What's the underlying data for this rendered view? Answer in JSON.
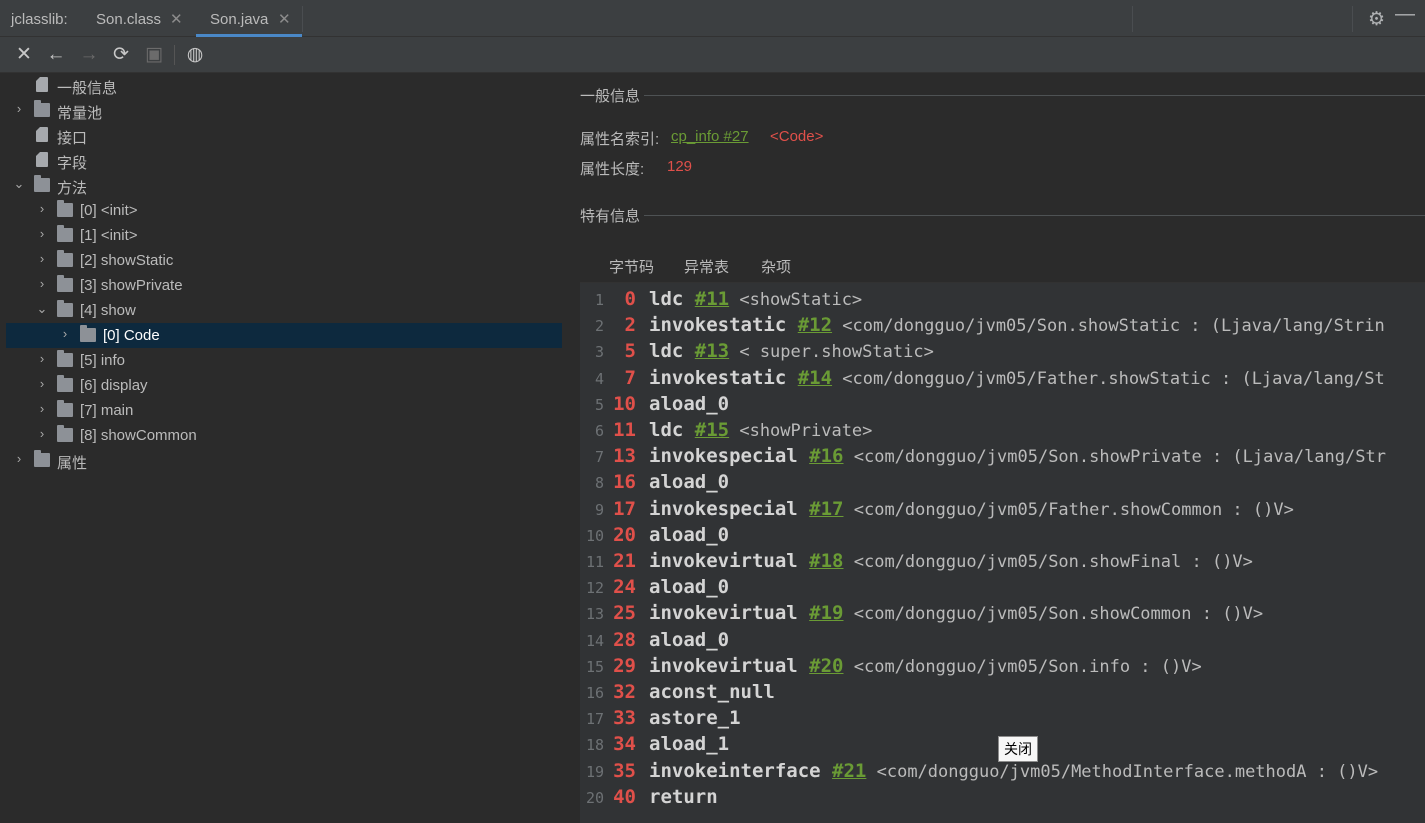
{
  "tabbar": {
    "app_label": "jclasslib:",
    "tabs": [
      {
        "label": "Son.class",
        "active": false
      },
      {
        "label": "Son.java",
        "active": true
      }
    ],
    "close_glyph": "✕",
    "settings_icon": "gear-icon",
    "minimize_glyph": "—"
  },
  "toolbar": {
    "buttons": [
      {
        "name": "close-icon",
        "glyph": "✕"
      },
      {
        "name": "back-arrow-icon",
        "glyph": "←"
      },
      {
        "name": "forward-arrow-icon",
        "glyph": "→",
        "disabled": true
      },
      {
        "name": "refresh-icon",
        "glyph": "⟳"
      },
      {
        "name": "save-icon",
        "glyph": "▣",
        "disabled": true
      },
      {
        "name": "web-browser-icon",
        "glyph": "◍"
      }
    ]
  },
  "tree": {
    "items": [
      {
        "label": "一般信息",
        "type": "file",
        "depth": 0,
        "expander": ""
      },
      {
        "label": "常量池",
        "type": "folder",
        "depth": 0,
        "expander": "›"
      },
      {
        "label": "接口",
        "type": "file",
        "depth": 0,
        "expander": ""
      },
      {
        "label": "字段",
        "type": "file",
        "depth": 0,
        "expander": ""
      },
      {
        "label": "方法",
        "type": "folder",
        "depth": 0,
        "expander": "⌄"
      },
      {
        "label": "[0] <init>",
        "type": "folder",
        "depth": 1,
        "expander": "›"
      },
      {
        "label": "[1] <init>",
        "type": "folder",
        "depth": 1,
        "expander": "›"
      },
      {
        "label": "[2] showStatic",
        "type": "folder",
        "depth": 1,
        "expander": "›"
      },
      {
        "label": "[3] showPrivate",
        "type": "folder",
        "depth": 1,
        "expander": "›"
      },
      {
        "label": "[4] show",
        "type": "folder",
        "depth": 1,
        "expander": "⌄"
      },
      {
        "label": "[0] Code",
        "type": "folder",
        "depth": 2,
        "expander": "›",
        "selected": true
      },
      {
        "label": "[5] info",
        "type": "folder",
        "depth": 1,
        "expander": "›"
      },
      {
        "label": "[6] display",
        "type": "folder",
        "depth": 1,
        "expander": "›"
      },
      {
        "label": "[7] main",
        "type": "folder",
        "depth": 1,
        "expander": "›"
      },
      {
        "label": "[8] showCommon",
        "type": "folder",
        "depth": 1,
        "expander": "›"
      },
      {
        "label": "属性",
        "type": "folder",
        "depth": 0,
        "expander": "›"
      }
    ]
  },
  "general": {
    "section_title": "一般信息",
    "name_index_label": "属性名索引:",
    "name_index_link": "cp_info #27",
    "name_index_value": "<Code>",
    "length_label": "属性长度:",
    "length_value": "129"
  },
  "specific": {
    "section_title": "特有信息",
    "tabs": [
      "字节码",
      "异常表",
      "杂项"
    ],
    "active_tab": "字节码"
  },
  "bytecode": [
    {
      "ln": "1",
      "off": "0",
      "op": "ldc",
      "ref": "#11",
      "rest": " <showStatic>"
    },
    {
      "ln": "2",
      "off": "2",
      "op": "invokestatic",
      "ref": "#12",
      "rest": " <com/dongguo/jvm05/Son.showStatic : (Ljava/lang/Strin"
    },
    {
      "ln": "3",
      "off": "5",
      "op": "ldc",
      "ref": "#13",
      "rest": " < super.showStatic>"
    },
    {
      "ln": "4",
      "off": "7",
      "op": "invokestatic",
      "ref": "#14",
      "rest": " <com/dongguo/jvm05/Father.showStatic : (Ljava/lang/St"
    },
    {
      "ln": "5",
      "off": "10",
      "op": "aload_0",
      "ref": "",
      "rest": ""
    },
    {
      "ln": "6",
      "off": "11",
      "op": "ldc",
      "ref": "#15",
      "rest": " <showPrivate>"
    },
    {
      "ln": "7",
      "off": "13",
      "op": "invokespecial",
      "ref": "#16",
      "rest": " <com/dongguo/jvm05/Son.showPrivate : (Ljava/lang/Str"
    },
    {
      "ln": "8",
      "off": "16",
      "op": "aload_0",
      "ref": "",
      "rest": ""
    },
    {
      "ln": "9",
      "off": "17",
      "op": "invokespecial",
      "ref": "#17",
      "rest": " <com/dongguo/jvm05/Father.showCommon : ()V>"
    },
    {
      "ln": "10",
      "off": "20",
      "op": "aload_0",
      "ref": "",
      "rest": ""
    },
    {
      "ln": "11",
      "off": "21",
      "op": "invokevirtual",
      "ref": "#18",
      "rest": " <com/dongguo/jvm05/Son.showFinal : ()V>"
    },
    {
      "ln": "12",
      "off": "24",
      "op": "aload_0",
      "ref": "",
      "rest": ""
    },
    {
      "ln": "13",
      "off": "25",
      "op": "invokevirtual",
      "ref": "#19",
      "rest": " <com/dongguo/jvm05/Son.showCommon : ()V>"
    },
    {
      "ln": "14",
      "off": "28",
      "op": "aload_0",
      "ref": "",
      "rest": ""
    },
    {
      "ln": "15",
      "off": "29",
      "op": "invokevirtual",
      "ref": "#20",
      "rest": " <com/dongguo/jvm05/Son.info : ()V>"
    },
    {
      "ln": "16",
      "off": "32",
      "op": "aconst_null",
      "ref": "",
      "rest": ""
    },
    {
      "ln": "17",
      "off": "33",
      "op": "astore_1",
      "ref": "",
      "rest": ""
    },
    {
      "ln": "18",
      "off": "34",
      "op": "aload_1",
      "ref": "",
      "rest": ""
    },
    {
      "ln": "19",
      "off": "35",
      "op": "invokeinterface",
      "ref": "#21",
      "rest": " <com/dongguo/jvm05/MethodInterface.methodA : ()V>"
    },
    {
      "ln": "20",
      "off": "40",
      "op": "return",
      "ref": "",
      "rest": ""
    }
  ],
  "tooltip": {
    "text": "关闭"
  },
  "colors": {
    "accent": "#4a88c7",
    "offset_red": "#e0504a",
    "ref_green": "#6a9b35",
    "selection": "#0d293e"
  }
}
